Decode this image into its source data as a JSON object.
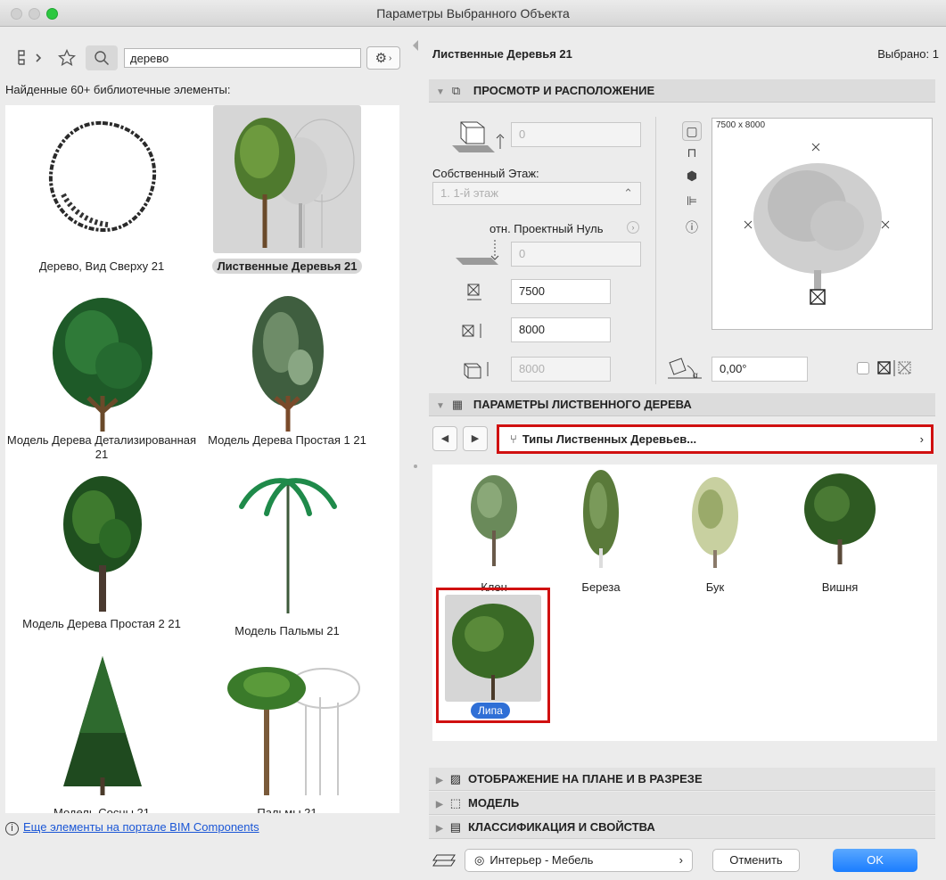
{
  "window": {
    "title": "Параметры Выбранного Объекта"
  },
  "search": {
    "value": "дерево"
  },
  "left": {
    "found_label": "Найденные 60+ библиотечные элементы:",
    "items": [
      {
        "label": "Дерево, Вид Сверху 21"
      },
      {
        "label": "Лиственные Деревья 21"
      },
      {
        "label": "Модель Дерева Детализированная 21"
      },
      {
        "label": "Модель Дерева Простая 1 21"
      },
      {
        "label": "Модель Дерева Простая 2 21"
      },
      {
        "label": "Модель Пальмы 21"
      },
      {
        "label": "Модель Сосны 21"
      },
      {
        "label": "Пальмы 21"
      }
    ],
    "bim_link": "Еще элементы на портале BIM Components"
  },
  "right": {
    "object_name": "Лиственные Деревья 21",
    "selected": "Выбрано: 1",
    "sections": {
      "preview": "ПРОСМОТР И РАСПОЛОЖЕНИЕ",
      "params": "ПАРАМЕТРЫ ЛИСТВЕННОГО ДЕРЕВА",
      "display": "ОТОБРАЖЕНИЕ НА ПЛАНЕ И В РАЗРЕЗЕ",
      "model": "МОДЕЛЬ",
      "classification": "КЛАССИФИКАЦИЯ И СВОЙСТВА"
    },
    "fields": {
      "elevation": "0",
      "own_story_label": "Собственный Этаж:",
      "story": "1. 1-й этаж",
      "ref_label": "отн. Проектный Нуль",
      "ref_value": "0",
      "width": "7500",
      "depth": "8000",
      "height": "8000",
      "angle": "0,00°"
    },
    "preview_dims": "7500 x 8000",
    "types_label": "Типы Лиственных Деревьев...",
    "types": [
      "Клен",
      "Береза",
      "Бук",
      "Вишня",
      "Липа"
    ],
    "layer": "Интерьер - Мебель",
    "cancel": "Отменить",
    "ok": "OK"
  }
}
